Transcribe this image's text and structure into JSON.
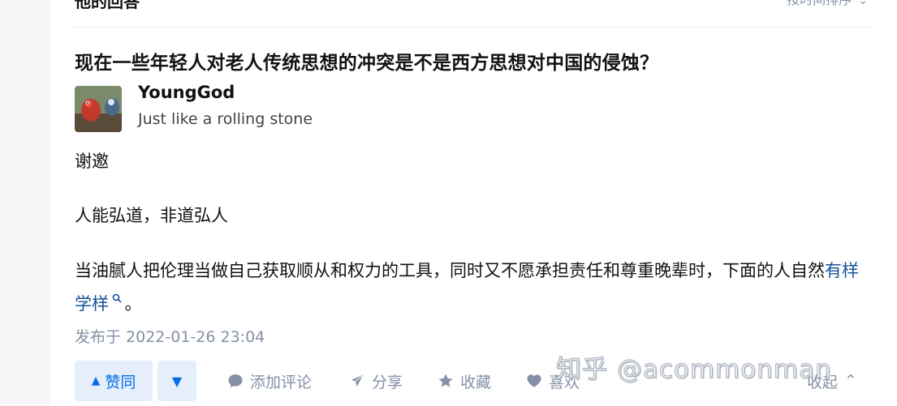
{
  "section": {
    "title": "他的回答",
    "sort_label": "按时间排序"
  },
  "answer": {
    "question_title": "现在一些年轻人对老人传统思想的冲突是不是西方思想对中国的侵蚀？",
    "author": {
      "name": "YoungGod",
      "bio": "Just like a rolling stone"
    },
    "paragraphs": {
      "p1": "谢邀",
      "p2": "人能弘道，非道弘人",
      "p3_before": "当油腻人把伦理当做自己获取顺从和权力的工具，同时又不愿承担责任和尊重晚辈时，下面的人自然",
      "p3_link": "有样学样",
      "p3_after": "。"
    },
    "publish_time": "发布于 2022-01-26 23:04"
  },
  "actions": {
    "upvote_label": "赞同",
    "comment_label": "添加评论",
    "share_label": "分享",
    "favorite_label": "收藏",
    "like_label": "喜欢",
    "collapse_label": "收起"
  },
  "watermark": "知乎 @acommonman",
  "colors": {
    "accent": "#056de8",
    "accent_bg": "#e5eefa",
    "link": "#175199",
    "muted": "#8590a6"
  }
}
